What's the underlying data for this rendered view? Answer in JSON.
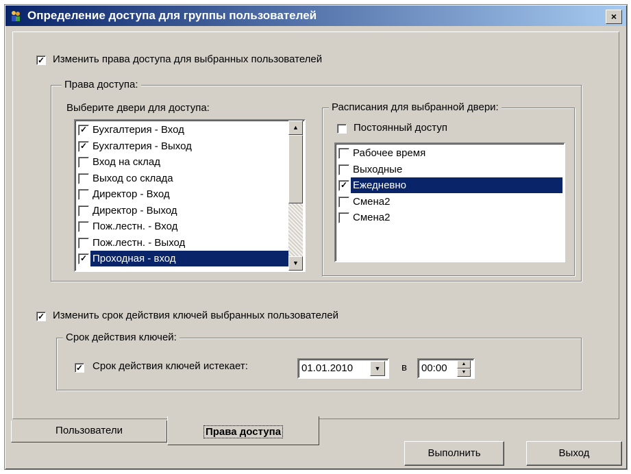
{
  "window": {
    "title": "Определение доступа для группы пользователей",
    "close_glyph": "×"
  },
  "section_access": {
    "checkbox_label": "Изменить права доступа для выбранных пользователей",
    "checked": true,
    "group_label": "Права доступа:",
    "doors_label": "Выберите двери для доступа:",
    "doors": [
      {
        "label": "Бухгалтерия - Вход",
        "checked": true,
        "selected": false
      },
      {
        "label": "Бухгалтерия - Выход",
        "checked": true,
        "selected": false
      },
      {
        "label": "Вход на склад",
        "checked": false,
        "selected": false
      },
      {
        "label": "Выход со склада",
        "checked": false,
        "selected": false
      },
      {
        "label": "Директор - Вход",
        "checked": false,
        "selected": false
      },
      {
        "label": "Директор - Выход",
        "checked": false,
        "selected": false
      },
      {
        "label": "Пож.лестн. - Вход",
        "checked": false,
        "selected": false
      },
      {
        "label": "Пож.лестн. - Выход",
        "checked": false,
        "selected": false
      },
      {
        "label": "Проходная - вход",
        "checked": true,
        "selected": true
      }
    ],
    "schedule_group_label": "Расписания для выбранной двери:",
    "permanent_label": "Постоянный доступ",
    "permanent_checked": false,
    "schedules": [
      {
        "label": "Рабочее время",
        "checked": false,
        "selected": false
      },
      {
        "label": "Выходные",
        "checked": false,
        "selected": false
      },
      {
        "label": "Ежедневно",
        "checked": true,
        "selected": true
      },
      {
        "label": "Смена2",
        "checked": false,
        "selected": false
      },
      {
        "label": "Смена2",
        "checked": false,
        "selected": false
      }
    ]
  },
  "section_expiry": {
    "checkbox_label": "Изменить срок действия ключей выбранных пользователей",
    "checked": true,
    "group_label": "Срок действия ключей:",
    "expires_label": "Срок действия ключей истекает:",
    "expires_checked": true,
    "date_value": "01.01.2010",
    "at_label": "в",
    "time_value": "00:00"
  },
  "tabs": [
    {
      "label": "Пользователи",
      "active": false
    },
    {
      "label": "Права доступа",
      "active": true
    }
  ],
  "buttons": {
    "execute": "Выполнить",
    "exit": "Выход"
  },
  "glyphs": {
    "check": "✓",
    "arrow_up": "▲",
    "arrow_down": "▼"
  }
}
